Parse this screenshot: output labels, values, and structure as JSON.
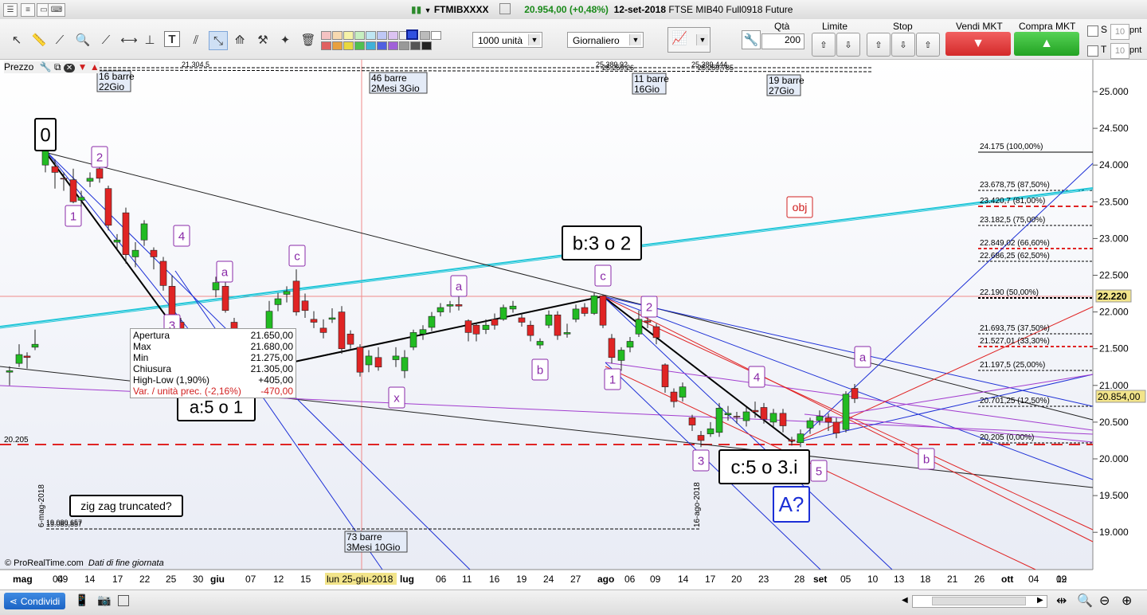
{
  "window": {
    "symbol": "FTMIBXXXX",
    "last_change": "20.954,00 (+0,48%)",
    "date": "12-set-2018",
    "instrument": "FTSE MIB40 Full0918 Future"
  },
  "toolbar": {
    "units_value": "1000 unità",
    "period_value": "Giornaliero",
    "qty_label": "Qtà",
    "qty_value": "200",
    "limit_label": "Limite",
    "stop_label": "Stop",
    "sell_label": "Vendi MKT",
    "buy_label": "Compra MKT",
    "s_label": "S",
    "t_label": "T",
    "s_points": "10",
    "t_points": "10",
    "points_unit": "pnt"
  },
  "chart": {
    "panel_label": "Prezzo",
    "copyright": "© ProRealTime.com",
    "data_note": "Dati di fine giornata",
    "current_price_tag": "20.854,00",
    "crosshair_price_tag": "22.220",
    "crosshair_date_tag": "lun 25-giu-2018",
    "left_level": "20.205",
    "price_axis": [
      "25.000",
      "24.500",
      "24.000",
      "23.500",
      "23.000",
      "22.500",
      "22.000",
      "21.500",
      "21.000",
      "20.500",
      "20.000",
      "19.500",
      "19.000"
    ],
    "date_axis": [
      "mag",
      "04",
      "09",
      "14",
      "17",
      "22",
      "25",
      "30",
      "giu",
      "07",
      "12",
      "15",
      "lug",
      "06",
      "11",
      "16",
      "19",
      "24",
      "27",
      "ago",
      "06",
      "09",
      "14",
      "17",
      "20",
      "23",
      "28",
      "set",
      "05",
      "10",
      "13",
      "18",
      "21",
      "26",
      "ott",
      "04",
      "09",
      "12"
    ],
    "fib_levels": [
      "24.175 (100,00%)",
      "23.678,75 (87,50%)",
      "23.420,7 (81,00%)",
      "23.182,5 (75,00%)",
      "22.849,02 (66,60%)",
      "22.686,25 (62,50%)",
      "22.190 (50,00%)",
      "21.693,75 (37,50%)",
      "21.527,01 (33,30%)",
      "21.197,5 (25,00%)",
      "20.701,25 (12,50%)",
      "20.205 (0,00%)"
    ],
    "bar_counts": [
      {
        "bars": "16 barre",
        "span": "22Gio"
      },
      {
        "bars": "46 barre",
        "span": "2Mesi 3Gio"
      },
      {
        "bars": "11 barre",
        "span": "16Gio"
      },
      {
        "bars": "19 barre",
        "span": "27Gio"
      },
      {
        "bars": "73 barre",
        "span": "3Mesi 10Gio"
      }
    ],
    "top_tiny_labels": [
      "21.304,5",
      "25.389,92",
      "25.259,26",
      "25.389,444",
      "25.259,785"
    ],
    "bottom_tiny_labels": [
      "19.080,657",
      "19.089,857"
    ],
    "vertical_dates": [
      "6-mag-2018",
      "16-ago-2018"
    ],
    "wave_labels": {
      "zero": "0",
      "w1": "1",
      "w2": "2",
      "w3": "3",
      "w4": "4",
      "a": "a",
      "c": "c",
      "x": "x",
      "b": "b",
      "obj": "obj",
      "five": "5"
    },
    "box_labels": {
      "a_label": "a:5 o 1",
      "b_label": "b:3 o 2",
      "c_label": "c:5 o 3.i",
      "A_label": "A?",
      "zigzag": "zig zag truncated?"
    },
    "ohlc": {
      "open_label": "Apertura",
      "open_value": "21.650,00",
      "max_label": "Max",
      "max_value": "21.680,00",
      "min_label": "Min",
      "min_value": "21.275,00",
      "close_label": "Chiusura",
      "close_value": "21.305,00",
      "hl_label": "High-Low (1,90%)",
      "hl_value": "+405,00",
      "var_label": "Var. / unità prec. (-2,16%)",
      "var_value": "-470,00"
    }
  },
  "statusbar": {
    "share_label": "Condividi"
  },
  "colors": {
    "up": "#22bb22",
    "down": "#e02424",
    "fib_line_red": "#e02424",
    "trend_blue": "#1c2fd6",
    "trend_cyan": "#20c6d8",
    "wave_purple": "#8a2aa8",
    "chart_bg_top": "#ffffff",
    "chart_bg_bottom": "#e9ecf5"
  }
}
